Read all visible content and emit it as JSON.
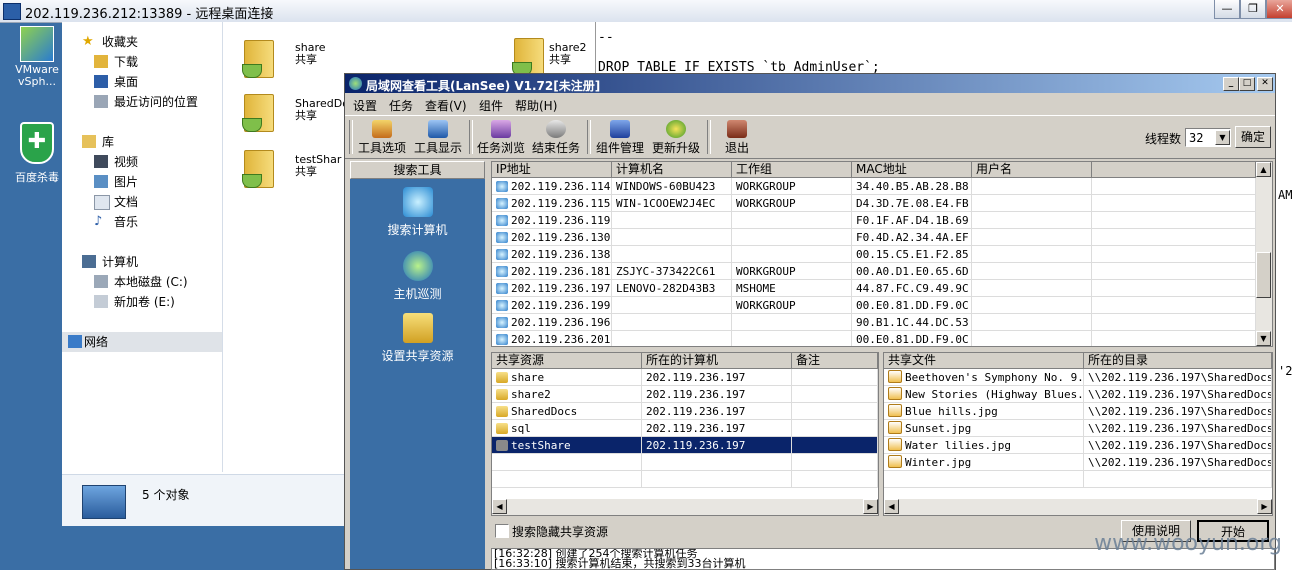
{
  "rdp": {
    "title": "202.119.236.212:13389 - 远程桌面连接"
  },
  "desktop": {
    "icons": [
      {
        "label": "VMware vSph..."
      },
      {
        "label": "百度杀毒"
      }
    ]
  },
  "explorer": {
    "nav": [
      {
        "label": "收藏夹"
      },
      {
        "label": "下载"
      },
      {
        "label": "桌面"
      },
      {
        "label": "最近访问的位置"
      },
      {
        "label": "库"
      },
      {
        "label": "视频"
      },
      {
        "label": "图片"
      },
      {
        "label": "文档"
      },
      {
        "label": "音乐"
      },
      {
        "label": "计算机"
      },
      {
        "label": "本地磁盘 (C:)"
      },
      {
        "label": "新加卷 (E:)"
      },
      {
        "label": "网络"
      }
    ],
    "files": [
      {
        "name": "share",
        "sub": "共享"
      },
      {
        "name": "SharedDo",
        "sub": "共享"
      },
      {
        "name": "testShar",
        "sub": "共享"
      },
      {
        "name": "share2",
        "sub": "共享"
      }
    ],
    "status": "5 个对象"
  },
  "sql": {
    "line1": "--",
    "line2": "DROP TABLE IF EXISTS `tb_AdminUser`;",
    "frag1": "AM",
    "frag2": "'2"
  },
  "lansee": {
    "title": "局域网查看工具(LanSee) V1.72[未注册]",
    "menu": [
      "设置",
      "任务",
      "查看(V)",
      "组件",
      "帮助(H)"
    ],
    "toolbar": [
      "工具选项",
      "工具显示",
      "任务浏览",
      "结束任务",
      "组件管理",
      "更新升级",
      "退出"
    ],
    "threads_label": "线程数",
    "threads_value": "32",
    "confirm_label": "确定",
    "side_header": "搜索工具",
    "side_buttons": [
      "搜索计算机",
      "主机巡测",
      "设置共享资源"
    ],
    "hosts": {
      "columns": [
        "IP地址",
        "计算机名",
        "工作组",
        "MAC地址",
        "用户名"
      ],
      "rows": [
        [
          "202.119.236.114",
          "WINDOWS-60BU423",
          "WORKGROUP",
          "34.40.B5.AB.28.B8",
          ""
        ],
        [
          "202.119.236.115",
          "WIN-1COOEW2J4EC",
          "WORKGROUP",
          "D4.3D.7E.08.E4.FB",
          ""
        ],
        [
          "202.119.236.119",
          "",
          "",
          "F0.1F.AF.D4.1B.69",
          ""
        ],
        [
          "202.119.236.130",
          "",
          "",
          "F0.4D.A2.34.4A.EF",
          ""
        ],
        [
          "202.119.236.138",
          "",
          "",
          "00.15.C5.E1.F2.85",
          ""
        ],
        [
          "202.119.236.181",
          "ZSJYC-373422C61",
          "WORKGROUP",
          "00.A0.D1.E0.65.6D",
          ""
        ],
        [
          "202.119.236.197",
          "LENOVO-282D43B3",
          "MSHOME",
          "44.87.FC.C9.49.9C",
          ""
        ],
        [
          "202.119.236.199",
          "",
          "WORKGROUP",
          "00.E0.81.DD.F9.0C",
          ""
        ],
        [
          "202.119.236.196",
          "",
          "",
          "90.B1.1C.44.DC.53",
          ""
        ],
        [
          "202.119.236.201",
          "",
          "",
          "00.E0.81.DD.F9.0C",
          ""
        ]
      ]
    },
    "shares": {
      "columns": [
        "共享资源",
        "所在的计算机",
        "备注"
      ],
      "rows": [
        [
          "share",
          "202.119.236.197",
          ""
        ],
        [
          "share2",
          "202.119.236.197",
          ""
        ],
        [
          "SharedDocs",
          "202.119.236.197",
          ""
        ],
        [
          "sql",
          "202.119.236.197",
          ""
        ],
        [
          "testShare",
          "202.119.236.197",
          ""
        ]
      ],
      "selected": 4
    },
    "files": {
      "columns": [
        "共享文件",
        "所在的目录"
      ],
      "rows": [
        [
          "Beethoven's Symphony No. 9...",
          "\\\\202.119.236.197\\SharedDocs..."
        ],
        [
          "New Stories (Highway Blues...",
          "\\\\202.119.236.197\\SharedDocs..."
        ],
        [
          "Blue hills.jpg",
          "\\\\202.119.236.197\\SharedDocs..."
        ],
        [
          "Sunset.jpg",
          "\\\\202.119.236.197\\SharedDocs..."
        ],
        [
          "Water lilies.jpg",
          "\\\\202.119.236.197\\SharedDocs..."
        ],
        [
          "Winter.jpg",
          "\\\\202.119.236.197\\SharedDocs..."
        ]
      ]
    },
    "hidden_share_label": "搜索隐藏共享资源",
    "help_label": "使用说明",
    "start_label": "开始",
    "log": [
      "[16:32:28] 创建了254个搜索计算机任务",
      "[16:33:10] 搜索计算机结束，共搜索到33台计算机"
    ]
  },
  "watermark": "www.wooyun.org",
  "colors": {
    "desktop": "#3a6ea5",
    "title_start": "#0a246a",
    "title_end": "#a6caf0",
    "selection": "#0a246a"
  }
}
